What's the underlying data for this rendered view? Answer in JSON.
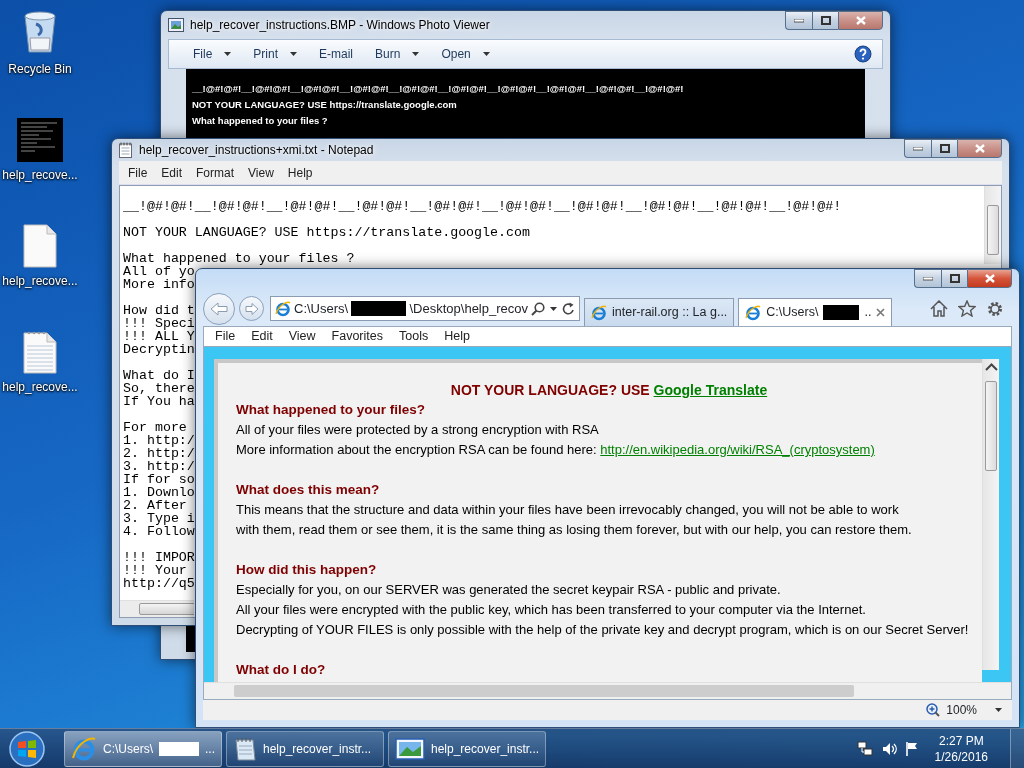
{
  "desktop_icons": [
    {
      "label": "Recycle Bin",
      "kind": "recycle"
    },
    {
      "label": "help_recove...",
      "kind": "image"
    },
    {
      "label": "help_recove...",
      "kind": "blank"
    },
    {
      "label": "help_recove...",
      "kind": "text"
    }
  ],
  "photo_viewer": {
    "title": "help_recover_instructions.BMP - Windows Photo Viewer",
    "toolbar": [
      {
        "label": "File",
        "dropdown": true
      },
      {
        "label": "Print",
        "dropdown": true
      },
      {
        "label": "E-mail",
        "dropdown": false
      },
      {
        "label": "Burn",
        "dropdown": true
      },
      {
        "label": "Open",
        "dropdown": true
      }
    ],
    "image_lines": [
      "__!@#!@#!__!@#!@#!__!@#!@#!__!@#!@#!__!@#!@#!__!@#!@#!__!@#!@#!__!@#!@#!__!@#!@#!__!@#!@#!",
      "NOT YOUR LANGUAGE? USE https://translate.google.com",
      "What happened to your files ?"
    ]
  },
  "notepad": {
    "title": "help_recover_instructions+xmi.txt - Notepad",
    "menu": [
      "File",
      "Edit",
      "Format",
      "View",
      "Help"
    ],
    "paragraphs": [
      [
        "__!@#!@#!__!@#!@#!__!@#!@#!__!@#!@#!__!@#!@#!__!@#!@#!__!@#!@#!__!@#!@#!__!@#!@#!__!@#!@#!"
      ],
      [
        "NOT YOUR LANGUAGE? USE https://translate.google.com"
      ],
      [
        "What happened to your files ?",
        "All of yo",
        "More info"
      ],
      [
        "How did t",
        "!!! Speci",
        "!!! ALL Y",
        "Decryptin"
      ],
      [
        "What do I",
        "So, there",
        "If You ha"
      ],
      [
        "For more",
        "1. http:/",
        "2. http:/",
        "3. http:/",
        "If for so",
        "1. Downlo",
        "2. After",
        "3. Type i",
        "4. Follow"
      ],
      [
        "!!! IMPOR",
        "!!! Your",
        "http://q5"
      ]
    ]
  },
  "browser": {
    "address": {
      "before": "C:\\Users\\",
      "after": "\\Desktop\\help_recov"
    },
    "tabs": [
      {
        "kind": "plain",
        "label": "inter-rail.org :: La g...",
        "selected": false
      },
      {
        "kind": "redacted",
        "before": "C:\\Users\\",
        "after": "..",
        "selected": true
      }
    ],
    "menu": [
      "File",
      "Edit",
      "View",
      "Favorites",
      "Tools",
      "Help"
    ],
    "page": {
      "title": "NOT YOUR LANGUAGE? USE",
      "title_link": "Google Translate",
      "sections": [
        {
          "heading": "What happened to your files?",
          "lines": [
            {
              "text": "All of your files were protected by a strong encryption with RSA"
            },
            {
              "text": "More information about the encryption RSA can be found here: ",
              "link": "http://en.wikipedia.org/wiki/RSA_(cryptosystem)"
            }
          ]
        },
        {
          "heading": "What does this mean?",
          "lines": [
            {
              "text": "This means that the structure and data within your files have been irrevocably changed, you will not be able to work"
            },
            {
              "text": "with them, read them or see them, it is the same thing as losing them forever, but with our help, you can restore them."
            }
          ]
        },
        {
          "heading": "How did this happen?",
          "lines": [
            {
              "text": "Especially for you, on our SERVER was generated the secret keypair RSA - public and private."
            },
            {
              "text": "All your files were encrypted with the public key, which has been transferred to your computer via the Internet."
            },
            {
              "text": "Decrypting of YOUR FILES is only possible with the help of the private key and decrypt program, which is on our Secret Server!"
            }
          ]
        },
        {
          "heading": "What do I do?"
        }
      ]
    },
    "zoom": "100%"
  },
  "taskbar": {
    "buttons": [
      {
        "kind": "browser",
        "before": "C:\\Users\\",
        "after": "...",
        "selected": true
      },
      {
        "kind": "notepad",
        "label": "help_recover_instr...",
        "selected": false
      },
      {
        "kind": "photos",
        "label": "help_recover_instr...",
        "selected": false
      }
    ],
    "time": "2:27 PM",
    "date": "1/26/2016"
  }
}
